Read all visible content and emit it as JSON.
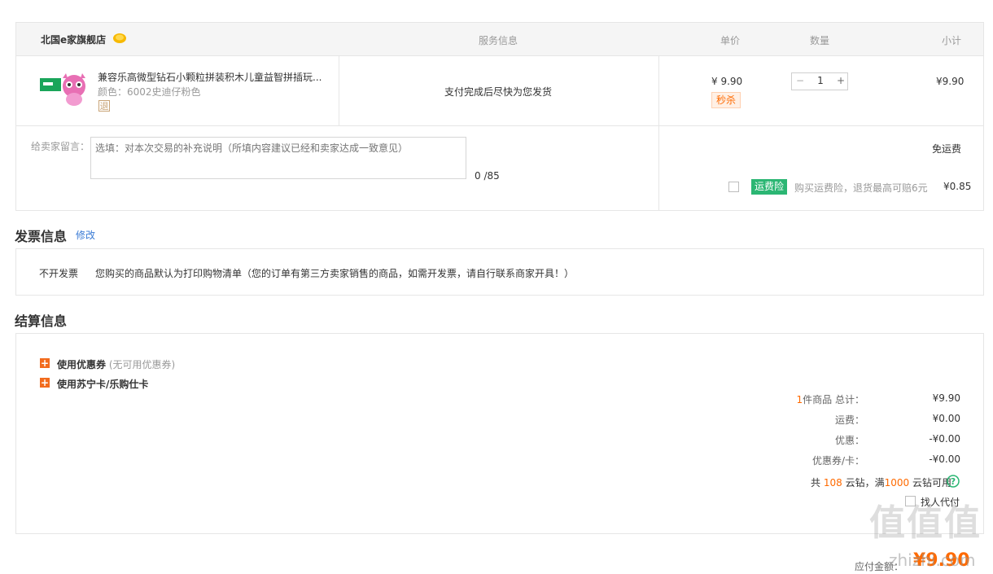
{
  "header": {
    "store_name": "北国e家旗舰店",
    "col_service": "服务信息",
    "col_price": "单价",
    "col_qty": "数量",
    "col_subtotal": "小计"
  },
  "item": {
    "title": "兼容乐高微型钻石小颗粒拼装积木儿童益智拼插玩...",
    "color_label": "颜色：",
    "color_value": "6002史迪仔粉色",
    "return_badge": "退",
    "service_text": "支付完成后尽快为您发货",
    "price": "¥ 9.90",
    "promo_badge": "秒杀",
    "qty_minus": "−",
    "qty_value": "1",
    "qty_plus": "+",
    "subtotal": "¥9.90"
  },
  "message": {
    "label": "给卖家留言：",
    "placeholder": "选填：对本次交易的补充说明（所填内容建议已经和卖家达成一致意见）",
    "counter": "0 /85"
  },
  "shipping": {
    "free_text": "免运费",
    "insurance_badge": "运费险",
    "insurance_desc": "购买运费险，退货最高可赔6元",
    "insurance_price": "¥0.85"
  },
  "invoice": {
    "title": "发票信息",
    "edit_link": "修改",
    "type": "不开发票",
    "desc": "您购买的商品默认为打印购物清单（您的订单有第三方卖家销售的商品，如需开发票，请自行联系商家开具！）"
  },
  "settlement": {
    "title": "结算信息",
    "coupon_label": "使用优惠券",
    "coupon_note": "(无可用优惠券)",
    "card_label": "使用苏宁卡/乐购仕卡",
    "items_count": "1",
    "items_label": "件商品 总计：",
    "total": "¥9.90",
    "freight_label": "运费：",
    "freight": "¥0.00",
    "discount_label": "优惠：",
    "discount": "-¥0.00",
    "coupon_card_label": "优惠券/卡：",
    "coupon_card": "-¥0.00",
    "diamond_prefix": "共",
    "diamond_count": "108",
    "diamond_mid": "云钻，满",
    "diamond_threshold": "1000",
    "diamond_suffix": "云钻可用",
    "proxy_pay_label": "找人代付",
    "payable_label": "应付金额：",
    "payable": "¥9.90"
  },
  "watermark": {
    "logo_text": "值值值",
    "site": "zhizhi.com"
  },
  "colors": {
    "accent_orange": "#ff6a00",
    "insurance_green": "#2bb673",
    "link_blue": "#3a7bd5",
    "plus_orange": "#f26b1d"
  }
}
